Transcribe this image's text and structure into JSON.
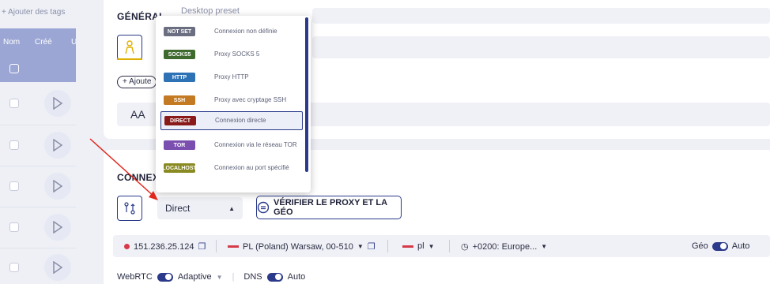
{
  "left_panel": {
    "add_tags": "+ Ajouter des tags",
    "col_name": "Nom",
    "col_created": "Créé",
    "col_u": "U"
  },
  "general": {
    "title": "GÉNÉRAL",
    "profile_select": "Desktop preset",
    "add_label": "+ Ajoute",
    "aa": "AA"
  },
  "connection": {
    "title": "CONNEXI",
    "proxy_type_selected": "Direct",
    "verify_button": "VÉRIFIER LE PROXY ET LA GÉO"
  },
  "proxy_bar": {
    "ip": "151.236.25.124",
    "location": "PL (Poland) Warsaw, 00-510",
    "lang": "pl",
    "timezone": "+0200: Europe...",
    "geo_label": "Géo",
    "geo_mode": "Auto"
  },
  "bottom": {
    "webrtc_label": "WebRTC",
    "webrtc_mode": "Adaptive",
    "dns_label": "DNS",
    "dns_mode": "Auto"
  },
  "dropdown": {
    "options": [
      {
        "badge": "NOT SET",
        "label": "Connexion non définie",
        "color": "#6b6e80"
      },
      {
        "badge": "SOCKS5",
        "label": "Proxy SOCKS 5",
        "color": "#3f6a2e"
      },
      {
        "badge": "HTTP",
        "label": "Proxy HTTP",
        "color": "#2e72b6"
      },
      {
        "badge": "SSH",
        "label": "Proxy avec cryptage SSH",
        "color": "#c47a22"
      },
      {
        "badge": "DIRECT",
        "label": "Connexion directe",
        "color": "#8a1a1a"
      },
      {
        "badge": "TOR",
        "label": "Connexion via le réseau TOR",
        "color": "#7b4fb0"
      },
      {
        "badge": "LOCALHOST",
        "label": "Connexion au port spécifié",
        "color": "#8a8a22"
      }
    ],
    "selected_index": 4
  }
}
